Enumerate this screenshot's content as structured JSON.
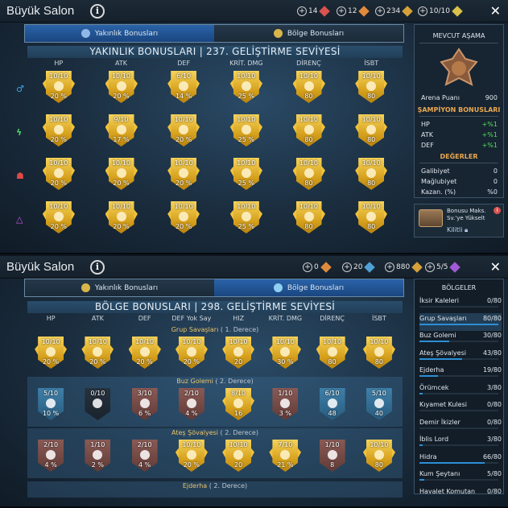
{
  "panel1": {
    "title": "Büyük Salon",
    "info": "i",
    "currencies": [
      {
        "plus": "+",
        "value": "14",
        "color": "#d9534f"
      },
      {
        "plus": "+",
        "value": "12",
        "color": "#e08a3c"
      },
      {
        "plus": "+",
        "value": "234",
        "color": "#9fb3c8"
      },
      {
        "plus": "+",
        "value": "10/10",
        "color": "#d8c24a"
      }
    ],
    "close": "✕",
    "tabs": [
      {
        "label": "Yakınlık Bonusları",
        "active": true
      },
      {
        "label": "Bölge Bonusları",
        "active": false
      }
    ],
    "header": "YAKINLIK BONUSLARI | 237. GELİŞTİRME SEVİYESİ",
    "columns": [
      "HP",
      "ATK",
      "DEF",
      "KRİT. DMG",
      "DİRENÇ",
      "İSBT"
    ],
    "affinities": [
      {
        "glyph": "♂",
        "color": "#3aa6e6"
      },
      {
        "glyph": "ϟ",
        "color": "#4ed06a"
      },
      {
        "glyph": "☗",
        "color": "#e04848"
      },
      {
        "glyph": "△",
        "color": "#c657e0"
      }
    ],
    "rows": [
      [
        {
          "c": "10/10",
          "p": "20 %"
        },
        {
          "c": "10/10",
          "p": "20 %"
        },
        {
          "c": "6/10",
          "p": "14 %"
        },
        {
          "c": "10/10",
          "p": "25 %"
        },
        {
          "c": "10/10",
          "p": "80"
        },
        {
          "c": "10/10",
          "p": "80"
        }
      ],
      [
        {
          "c": "10/10",
          "p": "20 %"
        },
        {
          "c": "9/10",
          "p": "17 %"
        },
        {
          "c": "10/10",
          "p": "20 %"
        },
        {
          "c": "10/10",
          "p": "25 %"
        },
        {
          "c": "10/10",
          "p": "80"
        },
        {
          "c": "10/10",
          "p": "80"
        }
      ],
      [
        {
          "c": "10/10",
          "p": "20 %"
        },
        {
          "c": "10/10",
          "p": "20 %"
        },
        {
          "c": "10/10",
          "p": "20 %"
        },
        {
          "c": "10/10",
          "p": "25 %"
        },
        {
          "c": "10/10",
          "p": "80"
        },
        {
          "c": "10/10",
          "p": "80"
        }
      ],
      [
        {
          "c": "10/10",
          "p": "20 %"
        },
        {
          "c": "10/10",
          "p": "20 %"
        },
        {
          "c": "10/10",
          "p": "20 %"
        },
        {
          "c": "10/10",
          "p": "25 %"
        },
        {
          "c": "10/10",
          "p": "80"
        },
        {
          "c": "10/10",
          "p": "80"
        }
      ]
    ],
    "side": {
      "title": "MEVCUT AŞAMA",
      "arena_label": "Arena Puanı",
      "arena_value": "900",
      "champ_title": "ŞAMPİYON BONUSLARI",
      "bonuses": [
        {
          "k": "HP",
          "v": "+%1"
        },
        {
          "k": "ATK",
          "v": "+%1"
        },
        {
          "k": "DEF",
          "v": "+%1"
        }
      ],
      "values_title": "DEĞERLER",
      "values": [
        {
          "k": "Galibiyet",
          "v": "0"
        },
        {
          "k": "Mağlubiyet",
          "v": "0"
        },
        {
          "k": "Kazan. (%)",
          "v": "%0"
        }
      ]
    },
    "chest": {
      "text": "Bonusu Maks. Sv.'ye Yükselt",
      "locked": "Kilitli"
    }
  },
  "panel2": {
    "title": "Büyük Salon",
    "info": "i",
    "currencies": [
      {
        "plus": "+",
        "value": "0",
        "color": "#e08a3c"
      },
      {
        "plus": "+",
        "value": "20",
        "color": "#e08a3c"
      },
      {
        "plus": "+",
        "value": "880",
        "color": "#9fb3c8"
      },
      {
        "plus": "+",
        "value": "5/5",
        "color": "#a25ad6"
      }
    ],
    "close": "✕",
    "tabs": [
      {
        "label": "Yakınlık Bonusları",
        "active": false
      },
      {
        "label": "Bölge Bonusları",
        "active": true
      }
    ],
    "header": "BÖLGE BONUSLARI | 298. GELİŞTİRME SEVİYESİ",
    "columns": [
      "HP",
      "ATK",
      "DEF",
      "DEF Yok Say",
      "HIZ",
      "KRİT. DMG",
      "DİRENÇ",
      "İSBT"
    ],
    "groups": [
      {
        "name": "Grup Savaşları",
        "tier": "( 1. Derece)",
        "badges": [
          {
            "c": "10/10",
            "p": "20 %",
            "t": "gold"
          },
          {
            "c": "10/10",
            "p": "20 %",
            "t": "gold"
          },
          {
            "c": "10/10",
            "p": "20 %",
            "t": "gold"
          },
          {
            "c": "10/10",
            "p": "20 %",
            "t": "gold"
          },
          {
            "c": "10/10",
            "p": "20",
            "t": "gold"
          },
          {
            "c": "10/10",
            "p": "30 %",
            "t": "gold"
          },
          {
            "c": "10/10",
            "p": "80",
            "t": "gold"
          },
          {
            "c": "10/10",
            "p": "80",
            "t": "gold"
          }
        ]
      },
      {
        "name": "Buz Golemi",
        "tier": "( 2. Derece)",
        "badges": [
          {
            "c": "5/10",
            "p": "10 %",
            "t": "blue"
          },
          {
            "c": "0/10",
            "p": "",
            "t": "dark"
          },
          {
            "c": "3/10",
            "p": "6 %",
            "t": "red"
          },
          {
            "c": "2/10",
            "p": "4 %",
            "t": "red"
          },
          {
            "c": "8/10",
            "p": "16",
            "t": "gold"
          },
          {
            "c": "1/10",
            "p": "3 %",
            "t": "red"
          },
          {
            "c": "6/10",
            "p": "48",
            "t": "blue"
          },
          {
            "c": "5/10",
            "p": "40",
            "t": "blue"
          }
        ]
      },
      {
        "name": "Ateş Şövalyesi",
        "tier": "( 2. Derece)",
        "badges": [
          {
            "c": "2/10",
            "p": "4 %",
            "t": "red"
          },
          {
            "c": "1/10",
            "p": "2 %",
            "t": "red"
          },
          {
            "c": "2/10",
            "p": "4 %",
            "t": "red"
          },
          {
            "c": "10/10",
            "p": "20 %",
            "t": "gold"
          },
          {
            "c": "10/10",
            "p": "20",
            "t": "gold"
          },
          {
            "c": "7/10",
            "p": "21 %",
            "t": "gold"
          },
          {
            "c": "1/10",
            "p": "8",
            "t": "red"
          },
          {
            "c": "10/10",
            "p": "80",
            "t": "gold"
          }
        ]
      },
      {
        "name": "Ejderha",
        "tier": "( 2. Derece)",
        "badges": []
      }
    ],
    "side": {
      "title": "BÖLGELER",
      "regions": [
        {
          "name": "İksir Kaleleri",
          "value": "0/80",
          "fill": 0.0,
          "hl": false
        },
        {
          "name": "Grup Savaşları",
          "value": "80/80",
          "fill": 1.0,
          "hl": true
        },
        {
          "name": "Buz Golemi",
          "value": "30/80",
          "fill": 0.375,
          "hl": false
        },
        {
          "name": "Ateş Şövalyesi",
          "value": "43/80",
          "fill": 0.5375,
          "hl": false
        },
        {
          "name": "Ejderha",
          "value": "19/80",
          "fill": 0.2375,
          "hl": false
        },
        {
          "name": "Örümcek",
          "value": "3/80",
          "fill": 0.0375,
          "hl": false
        },
        {
          "name": "Kıyamet Kulesi",
          "value": "0/80",
          "fill": 0.0,
          "hl": false
        },
        {
          "name": "Demir İkizler",
          "value": "0/80",
          "fill": 0.0,
          "hl": false
        },
        {
          "name": "İblis Lord",
          "value": "3/80",
          "fill": 0.0375,
          "hl": false
        },
        {
          "name": "Hidra",
          "value": "66/80",
          "fill": 0.825,
          "hl": false
        },
        {
          "name": "Kum Şeytanı",
          "value": "5/80",
          "fill": 0.0625,
          "hl": false
        },
        {
          "name": "Hayalet Komutan",
          "value": "0/80",
          "fill": 0.0,
          "hl": false
        }
      ]
    }
  }
}
